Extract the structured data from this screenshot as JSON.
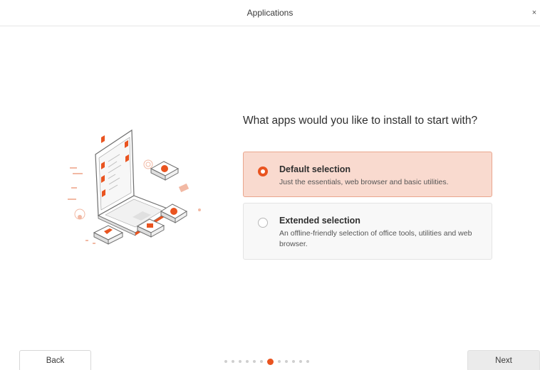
{
  "window": {
    "title": "Applications",
    "close_icon": "×"
  },
  "main": {
    "question": "What apps would you like to install to start with?",
    "options": [
      {
        "title": "Default selection",
        "description": "Just the essentials, web browser and basic utilities.",
        "selected": true
      },
      {
        "title": "Extended selection",
        "description": "An offline-friendly selection of office tools, utilities and web browser.",
        "selected": false
      }
    ]
  },
  "footer": {
    "back_label": "Back",
    "next_label": "Next",
    "progress": {
      "total_steps": 12,
      "current_step": 7
    }
  },
  "colors": {
    "accent": "#E95420",
    "selected_bg": "#F9DACF"
  },
  "icons": [
    "close-icon",
    "laptop-illustration",
    "radio-selected-icon",
    "radio-unselected-icon"
  ]
}
